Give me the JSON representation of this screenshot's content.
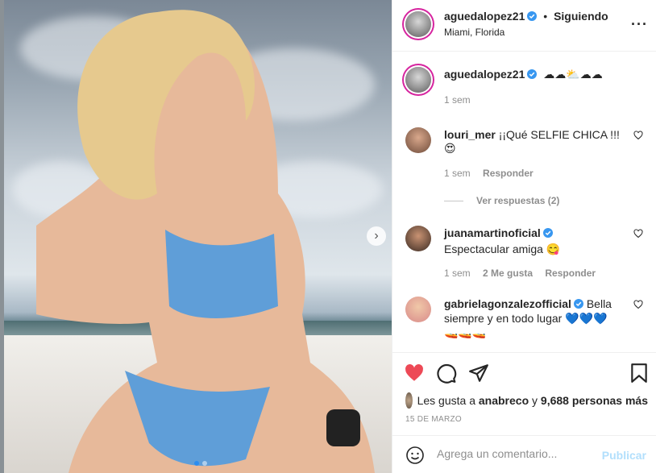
{
  "post": {
    "author": "aguedalopez21",
    "follow_separator": "•",
    "follow_status": "Siguiendo",
    "location": "Miami, Florida",
    "caption_emoji": "☁☁⛅☁☁",
    "caption_time": "1 sem",
    "more_icon": "more-horizontal-icon",
    "carousel_next_icon": "chevron-right-icon"
  },
  "comments": [
    {
      "user": "louri_mer",
      "verified": false,
      "text": "¡¡Qué SELFIE CHICA !!!",
      "text2": "😍",
      "time": "1 sem",
      "likes": "",
      "reply": "Responder",
      "view_replies": "Ver respuestas (2)"
    },
    {
      "user": "juanamartinoficial",
      "verified": true,
      "text": "Espectacular amiga 😋",
      "text2": "",
      "time": "1 sem",
      "likes": "2 Me gusta",
      "reply": "Responder"
    },
    {
      "user": "gabrielagonzalezofficial",
      "verified": true,
      "text": "Bella siempre y en todo lugar 💙💙💙",
      "text2": "🚤🚤🚤",
      "time": "",
      "likes": "",
      "reply": ""
    }
  ],
  "likes_line": {
    "prefix": "Les gusta a",
    "user": "anabreco",
    "middle": "y",
    "count": "9,688 personas más"
  },
  "date": "15 DE MARZO",
  "add_comment": {
    "placeholder": "Agrega un comentario...",
    "publish": "Publicar"
  },
  "colors": {
    "verified": "#3897f0",
    "liked": "#ed4956",
    "publish_disabled": "#b2dffc"
  }
}
